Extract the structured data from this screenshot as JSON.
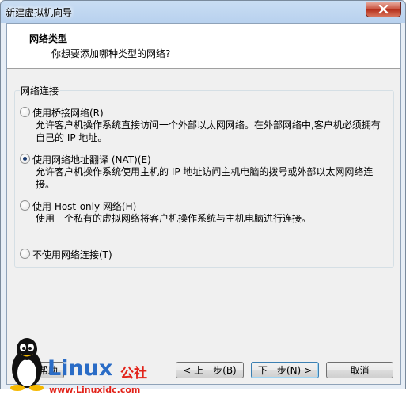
{
  "window": {
    "title": "新建虚拟机向导"
  },
  "header": {
    "title": "网络类型",
    "subtitle": "你想要添加哪种类型的网络?"
  },
  "group": {
    "label": "网络连接"
  },
  "options": [
    {
      "label": "使用桥接网络(R)",
      "checked": false,
      "desc": "允许客户机操作系统直接访问一个外部以太网网络。在外部网络中,客户机必须拥有自己的 IP 地址。"
    },
    {
      "label": "使用网络地址翻译 (NAT)(E)",
      "checked": true,
      "desc": "允许客户机操作系统使用主机的 IP 地址访问主机电脑的拨号或外部以太网网络连接。"
    },
    {
      "label": "使用 Host-only 网络(H)",
      "checked": false,
      "desc": "使用一个私有的虚拟网络将客户机操作系统与主机电脑进行连接。"
    },
    {
      "label": "不使用网络连接(T)",
      "checked": false,
      "desc": ""
    }
  ],
  "buttons": {
    "help": "帮助",
    "back": "< 上一步(B)",
    "next": "下一步(N) >",
    "cancel": "取消"
  },
  "watermark": {
    "brand": "Linux",
    "brand_cn": "公社",
    "url": "www.Linuxidc.com"
  },
  "colors": {
    "accent": "#3c7fb1",
    "watermark_blue": "#2a6cc6",
    "watermark_red": "#e2231a"
  }
}
